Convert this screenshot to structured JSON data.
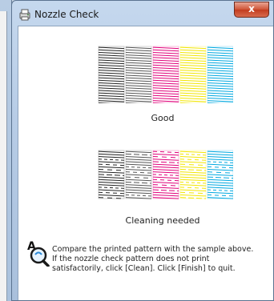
{
  "window": {
    "title": "Nozzle Check",
    "close_glyph": "x",
    "app_icon": "printer-icon",
    "close_icon": "close-icon"
  },
  "samples": [
    {
      "label": "Good",
      "state": "good"
    },
    {
      "label": "Cleaning needed",
      "state": "cleaning-needed"
    }
  ],
  "pattern_colors": [
    "#222222",
    "#555555",
    "#e0007a",
    "#f2e600",
    "#00a8e0"
  ],
  "message": {
    "icon": "help-search-icon",
    "text": "Compare the printed pattern with the sample above. If the nozzle check pattern does not print satisfactorily, click [Clean]. Click [Finish] to quit."
  }
}
